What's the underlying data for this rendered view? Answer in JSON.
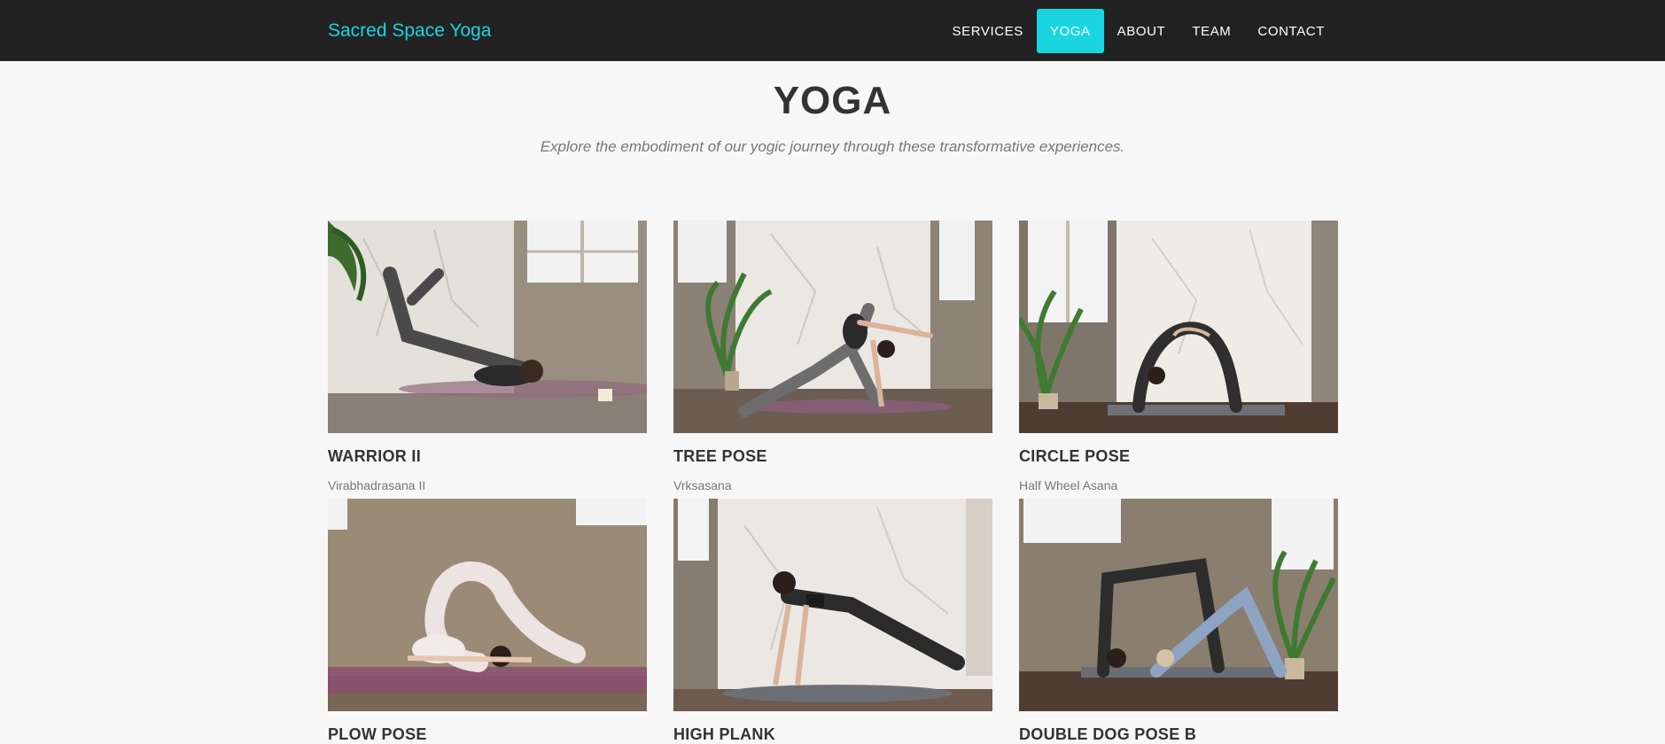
{
  "header": {
    "brand": "Sacred Space Yoga",
    "nav": [
      "SERVICES",
      "YOGA",
      "ABOUT",
      "TEAM",
      "CONTACT"
    ],
    "active_nav": "YOGA"
  },
  "section": {
    "title": "YOGA",
    "subtitle": "Explore the embodiment of our yogic journey through these transformative experiences."
  },
  "poses": [
    {
      "title": "WARRIOR II",
      "subtitle": "Virabhadrasana II"
    },
    {
      "title": "TREE POSE",
      "subtitle": "Vrksasana"
    },
    {
      "title": "CIRCLE POSE",
      "subtitle": "Half Wheel Asana"
    },
    {
      "title": "PLOW POSE",
      "subtitle": ""
    },
    {
      "title": "HIGH PLANK",
      "subtitle": ""
    },
    {
      "title": "DOUBLE DOG POSE B",
      "subtitle": ""
    }
  ],
  "colors": {
    "accent": "#1ad5e0",
    "navbar": "#222222",
    "background": "#f7f7f7"
  }
}
